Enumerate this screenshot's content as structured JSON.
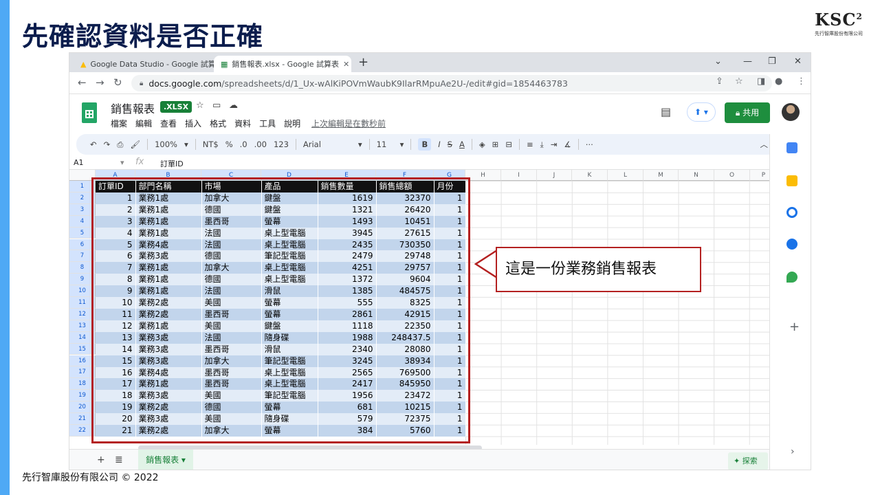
{
  "slide": {
    "title": "先確認資料是否正確",
    "footer": "先行智庫股份有限公司 © 2022",
    "accent_color": "#4fa9f5"
  },
  "logo": {
    "text": "KSC",
    "sup": "2",
    "subtitle": "先行智庫股份有限公司"
  },
  "browser": {
    "tabs": [
      {
        "title": "Google Data Studio - Google 試算表",
        "icon": "data-studio-icon",
        "active": false
      },
      {
        "title": "銷售報表.xlsx - Google 試算表",
        "icon": "sheets-icon",
        "active": true
      }
    ],
    "url_host": "docs.google.com",
    "url_path": "/spreadsheets/d/1_Ux-wAlKiPOVmWaubK9IlarRMpuAe2U-/edit#gid=1854463783"
  },
  "sheets": {
    "doc_name": "銷售報表",
    "badge": ".XLSX",
    "menu": [
      "檔案",
      "編輯",
      "查看",
      "插入",
      "格式",
      "資料",
      "工具",
      "說明"
    ],
    "last_edit": "上次編輯是在數秒前",
    "share_label": "共用",
    "toolbar": {
      "zoom": "100%",
      "currency": "NT$",
      "percent": "%",
      "decrease_decimal": ".0",
      "increase_decimal": ".00",
      "number_format": "123",
      "font": "Arial",
      "font_size": "11"
    },
    "cell_ref": "A1",
    "formula_value": "訂單ID",
    "column_letters": [
      "A",
      "B",
      "C",
      "D",
      "E",
      "F",
      "G",
      "H",
      "I",
      "J",
      "K",
      "L",
      "M",
      "N",
      "O",
      "P"
    ],
    "row_numbers": [
      "1",
      "2",
      "3",
      "4",
      "5",
      "6",
      "7",
      "8",
      "9",
      "10",
      "11",
      "12",
      "13",
      "14",
      "15",
      "16",
      "17",
      "18",
      "19",
      "20",
      "21",
      "22"
    ],
    "headers": [
      "訂單ID",
      "部門名稱",
      "市場",
      "產品",
      "銷售數量",
      "銷售總額",
      "月份"
    ],
    "rows": [
      [
        "1",
        "業務1處",
        "加拿大",
        "鍵盤",
        "1619",
        "32370",
        "1"
      ],
      [
        "2",
        "業務1處",
        "德國",
        "鍵盤",
        "1321",
        "26420",
        "1"
      ],
      [
        "3",
        "業務1處",
        "墨西哥",
        "螢幕",
        "1493",
        "10451",
        "1"
      ],
      [
        "4",
        "業務1處",
        "法國",
        "桌上型電腦",
        "3945",
        "27615",
        "1"
      ],
      [
        "5",
        "業務4處",
        "法國",
        "桌上型電腦",
        "2435",
        "730350",
        "1"
      ],
      [
        "6",
        "業務3處",
        "德國",
        "筆記型電腦",
        "2479",
        "29748",
        "1"
      ],
      [
        "7",
        "業務1處",
        "加拿大",
        "桌上型電腦",
        "4251",
        "29757",
        "1"
      ],
      [
        "8",
        "業務1處",
        "德國",
        "桌上型電腦",
        "1372",
        "9604",
        "1"
      ],
      [
        "9",
        "業務1處",
        "法國",
        "滑鼠",
        "1385",
        "484575",
        "1"
      ],
      [
        "10",
        "業務2處",
        "美國",
        "螢幕",
        "555",
        "8325",
        "1"
      ],
      [
        "11",
        "業務2處",
        "墨西哥",
        "螢幕",
        "2861",
        "42915",
        "1"
      ],
      [
        "12",
        "業務1處",
        "美國",
        "鍵盤",
        "1118",
        "22350",
        "1"
      ],
      [
        "13",
        "業務3處",
        "法國",
        "隨身碟",
        "1988",
        "248437.5",
        "1"
      ],
      [
        "14",
        "業務3處",
        "墨西哥",
        "滑鼠",
        "2340",
        "28080",
        "1"
      ],
      [
        "15",
        "業務3處",
        "加拿大",
        "筆記型電腦",
        "3245",
        "38934",
        "1"
      ],
      [
        "16",
        "業務4處",
        "墨西哥",
        "桌上型電腦",
        "2565",
        "769500",
        "1"
      ],
      [
        "17",
        "業務1處",
        "墨西哥",
        "桌上型電腦",
        "2417",
        "845950",
        "1"
      ],
      [
        "18",
        "業務3處",
        "美國",
        "筆記型電腦",
        "1956",
        "23472",
        "1"
      ],
      [
        "19",
        "業務2處",
        "德國",
        "螢幕",
        "681",
        "10215",
        "1"
      ],
      [
        "20",
        "業務3處",
        "美國",
        "隨身碟",
        "579",
        "72375",
        "1"
      ],
      [
        "21",
        "業務2處",
        "加拿大",
        "螢幕",
        "384",
        "5760",
        "1"
      ]
    ],
    "sheet_tab": "銷售報表",
    "explore_label": "探索"
  },
  "callout": {
    "text": "這是一份業務銷售報表",
    "border_color": "#b42020"
  }
}
